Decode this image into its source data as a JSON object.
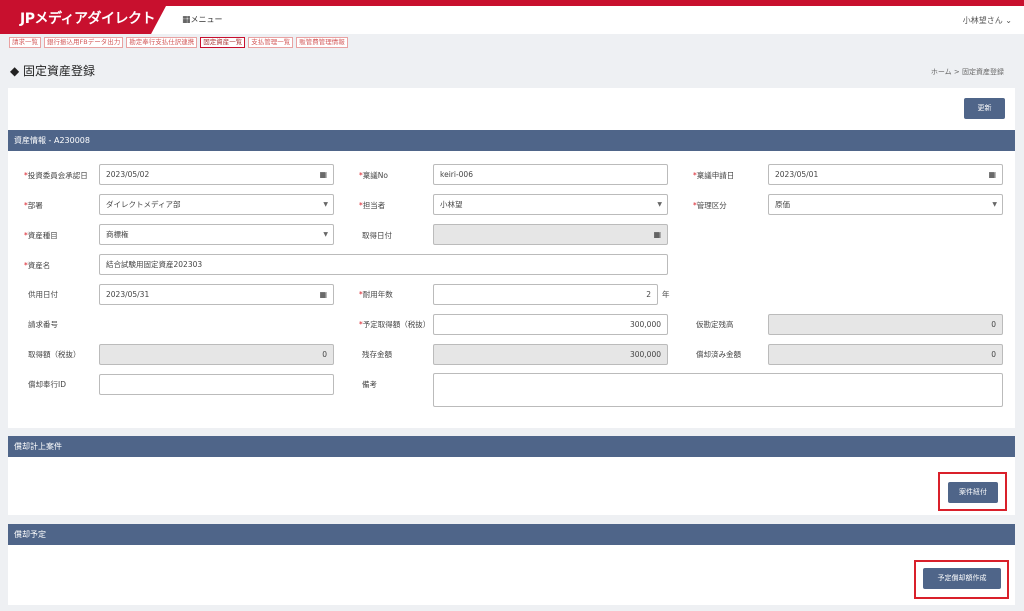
{
  "app": {
    "logo": "JPメディアダイレクト",
    "menu_label": "メニュー",
    "user": "小林望さん ⌄"
  },
  "tabs": [
    "請求一覧",
    "銀行振込用FBデータ出力",
    "勘定奉行支払仕訳連携",
    "固定資産一覧",
    "支払管理一覧",
    "販管費管理情報"
  ],
  "page": {
    "title": "固定資産登録",
    "breadcrumb": "ホーム >  固定資産登録"
  },
  "toolbar": {
    "update_label": "更新"
  },
  "asset_section": {
    "title": "資産情報 - A230008"
  },
  "form": {
    "investment_committee_date": {
      "label": "投資委員会承認日",
      "value": "2023/05/02"
    },
    "ringi_no": {
      "label": "稟議No",
      "value": "keiri-006"
    },
    "ringi_request_date": {
      "label": "稟議申請日",
      "value": "2023/05/01"
    },
    "department": {
      "label": "部署",
      "value": "ダイレクトメディア部"
    },
    "person": {
      "label": "担当者",
      "value": "小林望"
    },
    "mgmt_category": {
      "label": "管理区分",
      "value": "原価"
    },
    "asset_type": {
      "label": "資産種目",
      "value": "商標権"
    },
    "acquisition_date": {
      "label": "取得日付",
      "value": ""
    },
    "asset_name": {
      "label": "資産名",
      "value": "結合試験用固定資産202303"
    },
    "service_date": {
      "label": "供用日付",
      "value": "2023/05/31"
    },
    "useful_life": {
      "label": "耐用年数",
      "value": "2",
      "unit": "年"
    },
    "invoice_no": {
      "label": "請求番号"
    },
    "planned_cost": {
      "label": "予定取得額（税抜）",
      "value": "300,000"
    },
    "provisional_balance": {
      "label": "仮勘定残高",
      "value": "0"
    },
    "acquisition_cost": {
      "label": "取得額（税抜）",
      "value": "0"
    },
    "residual_amount": {
      "label": "残存金額",
      "value": "300,000"
    },
    "depreciated_amount": {
      "label": "償却済み金額",
      "value": "0"
    },
    "bugyo_id": {
      "label": "償却奉行ID",
      "value": ""
    },
    "remarks": {
      "label": "備考",
      "value": ""
    }
  },
  "depreciation_case": {
    "title": "償却計上案件",
    "button": "案件紐付"
  },
  "depreciation_plan": {
    "title": "償却予定",
    "button": "予定償却額作成"
  },
  "colors": {
    "brand_red": "#c8102e",
    "section_header": "#4f6589",
    "button": "#4f6589",
    "highlight": "#d9202a"
  },
  "icons": {
    "calendar": "calendar-icon",
    "dropdown": "chevron-down-icon",
    "menu": "grid-icon"
  }
}
